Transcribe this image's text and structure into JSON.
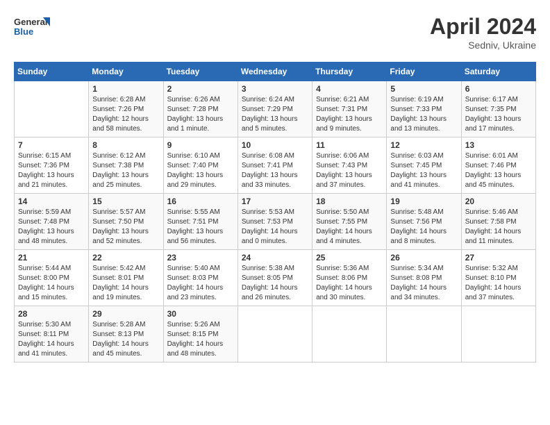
{
  "header": {
    "logo_line1": "General",
    "logo_line2": "Blue",
    "month_year": "April 2024",
    "location": "Sedniv, Ukraine"
  },
  "weekdays": [
    "Sunday",
    "Monday",
    "Tuesday",
    "Wednesday",
    "Thursday",
    "Friday",
    "Saturday"
  ],
  "weeks": [
    [
      {
        "day": "",
        "info": ""
      },
      {
        "day": "1",
        "info": "Sunrise: 6:28 AM\nSunset: 7:26 PM\nDaylight: 12 hours\nand 58 minutes."
      },
      {
        "day": "2",
        "info": "Sunrise: 6:26 AM\nSunset: 7:28 PM\nDaylight: 13 hours\nand 1 minute."
      },
      {
        "day": "3",
        "info": "Sunrise: 6:24 AM\nSunset: 7:29 PM\nDaylight: 13 hours\nand 5 minutes."
      },
      {
        "day": "4",
        "info": "Sunrise: 6:21 AM\nSunset: 7:31 PM\nDaylight: 13 hours\nand 9 minutes."
      },
      {
        "day": "5",
        "info": "Sunrise: 6:19 AM\nSunset: 7:33 PM\nDaylight: 13 hours\nand 13 minutes."
      },
      {
        "day": "6",
        "info": "Sunrise: 6:17 AM\nSunset: 7:35 PM\nDaylight: 13 hours\nand 17 minutes."
      }
    ],
    [
      {
        "day": "7",
        "info": "Sunrise: 6:15 AM\nSunset: 7:36 PM\nDaylight: 13 hours\nand 21 minutes."
      },
      {
        "day": "8",
        "info": "Sunrise: 6:12 AM\nSunset: 7:38 PM\nDaylight: 13 hours\nand 25 minutes."
      },
      {
        "day": "9",
        "info": "Sunrise: 6:10 AM\nSunset: 7:40 PM\nDaylight: 13 hours\nand 29 minutes."
      },
      {
        "day": "10",
        "info": "Sunrise: 6:08 AM\nSunset: 7:41 PM\nDaylight: 13 hours\nand 33 minutes."
      },
      {
        "day": "11",
        "info": "Sunrise: 6:06 AM\nSunset: 7:43 PM\nDaylight: 13 hours\nand 37 minutes."
      },
      {
        "day": "12",
        "info": "Sunrise: 6:03 AM\nSunset: 7:45 PM\nDaylight: 13 hours\nand 41 minutes."
      },
      {
        "day": "13",
        "info": "Sunrise: 6:01 AM\nSunset: 7:46 PM\nDaylight: 13 hours\nand 45 minutes."
      }
    ],
    [
      {
        "day": "14",
        "info": "Sunrise: 5:59 AM\nSunset: 7:48 PM\nDaylight: 13 hours\nand 48 minutes."
      },
      {
        "day": "15",
        "info": "Sunrise: 5:57 AM\nSunset: 7:50 PM\nDaylight: 13 hours\nand 52 minutes."
      },
      {
        "day": "16",
        "info": "Sunrise: 5:55 AM\nSunset: 7:51 PM\nDaylight: 13 hours\nand 56 minutes."
      },
      {
        "day": "17",
        "info": "Sunrise: 5:53 AM\nSunset: 7:53 PM\nDaylight: 14 hours\nand 0 minutes."
      },
      {
        "day": "18",
        "info": "Sunrise: 5:50 AM\nSunset: 7:55 PM\nDaylight: 14 hours\nand 4 minutes."
      },
      {
        "day": "19",
        "info": "Sunrise: 5:48 AM\nSunset: 7:56 PM\nDaylight: 14 hours\nand 8 minutes."
      },
      {
        "day": "20",
        "info": "Sunrise: 5:46 AM\nSunset: 7:58 PM\nDaylight: 14 hours\nand 11 minutes."
      }
    ],
    [
      {
        "day": "21",
        "info": "Sunrise: 5:44 AM\nSunset: 8:00 PM\nDaylight: 14 hours\nand 15 minutes."
      },
      {
        "day": "22",
        "info": "Sunrise: 5:42 AM\nSunset: 8:01 PM\nDaylight: 14 hours\nand 19 minutes."
      },
      {
        "day": "23",
        "info": "Sunrise: 5:40 AM\nSunset: 8:03 PM\nDaylight: 14 hours\nand 23 minutes."
      },
      {
        "day": "24",
        "info": "Sunrise: 5:38 AM\nSunset: 8:05 PM\nDaylight: 14 hours\nand 26 minutes."
      },
      {
        "day": "25",
        "info": "Sunrise: 5:36 AM\nSunset: 8:06 PM\nDaylight: 14 hours\nand 30 minutes."
      },
      {
        "day": "26",
        "info": "Sunrise: 5:34 AM\nSunset: 8:08 PM\nDaylight: 14 hours\nand 34 minutes."
      },
      {
        "day": "27",
        "info": "Sunrise: 5:32 AM\nSunset: 8:10 PM\nDaylight: 14 hours\nand 37 minutes."
      }
    ],
    [
      {
        "day": "28",
        "info": "Sunrise: 5:30 AM\nSunset: 8:11 PM\nDaylight: 14 hours\nand 41 minutes."
      },
      {
        "day": "29",
        "info": "Sunrise: 5:28 AM\nSunset: 8:13 PM\nDaylight: 14 hours\nand 45 minutes."
      },
      {
        "day": "30",
        "info": "Sunrise: 5:26 AM\nSunset: 8:15 PM\nDaylight: 14 hours\nand 48 minutes."
      },
      {
        "day": "",
        "info": ""
      },
      {
        "day": "",
        "info": ""
      },
      {
        "day": "",
        "info": ""
      },
      {
        "day": "",
        "info": ""
      }
    ]
  ]
}
